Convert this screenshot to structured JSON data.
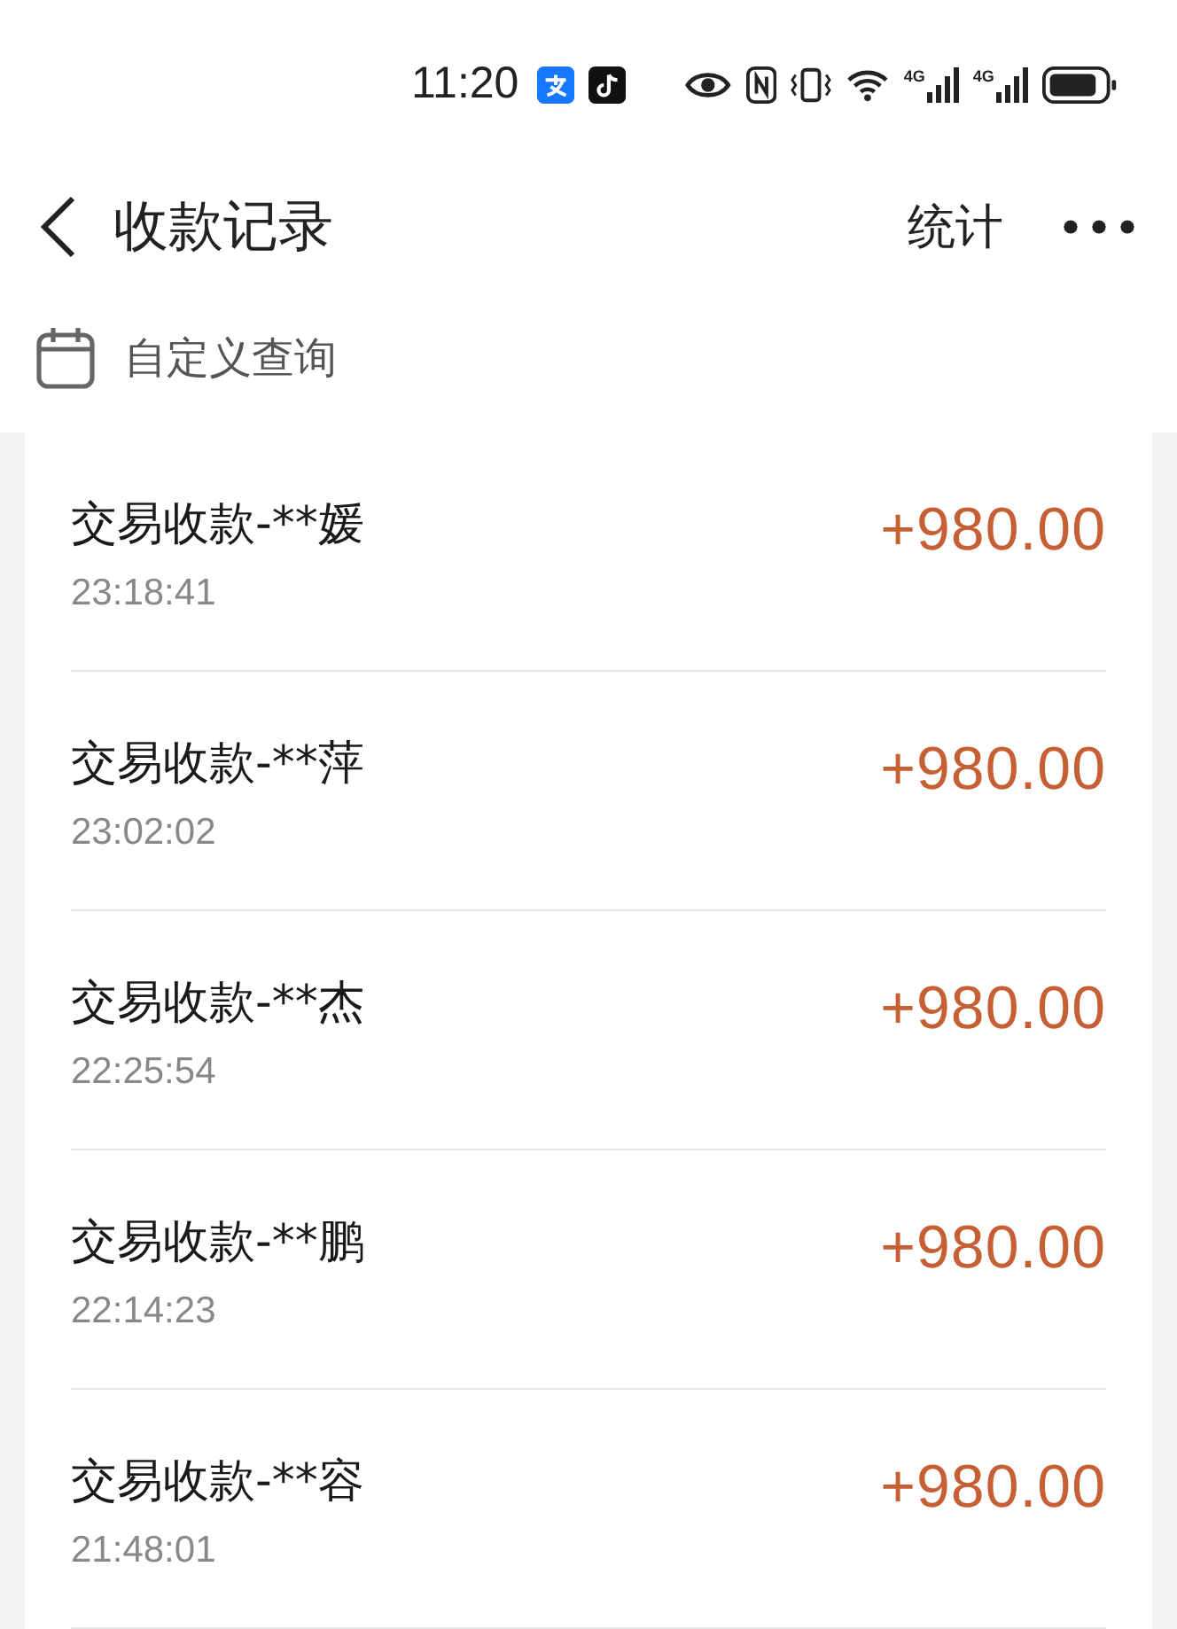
{
  "status_bar": {
    "time": "11:20",
    "network_labels": [
      "4G",
      "4G"
    ]
  },
  "header": {
    "title": "收款记录",
    "action": "统计"
  },
  "query": {
    "label": "自定义查询"
  },
  "records": [
    {
      "title": "交易收款-**媛",
      "time": "23:18:41",
      "amount": "+980.00"
    },
    {
      "title": "交易收款-**萍",
      "time": "23:02:02",
      "amount": "+980.00"
    },
    {
      "title": "交易收款-**杰",
      "time": "22:25:54",
      "amount": "+980.00"
    },
    {
      "title": "交易收款-**鹏",
      "time": "22:14:23",
      "amount": "+980.00"
    },
    {
      "title": "交易收款-**容",
      "time": "21:48:01",
      "amount": "+980.00"
    }
  ]
}
